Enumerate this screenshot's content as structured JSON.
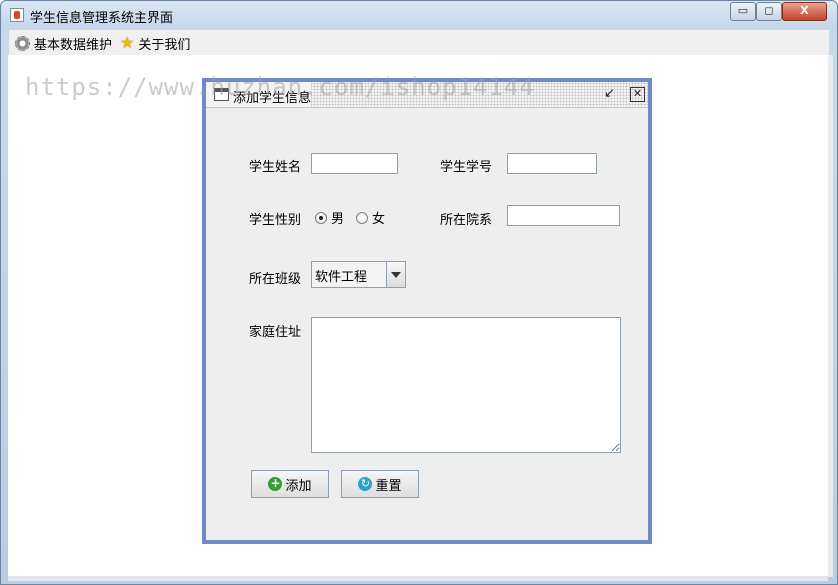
{
  "window": {
    "title": "学生信息管理系统主界面",
    "minimize": "▭",
    "maximize": "◻",
    "close": "X"
  },
  "menubar": {
    "items": [
      {
        "label": "基本数据维护",
        "icon": "gear-icon"
      },
      {
        "label": "关于我们",
        "icon": "star-icon"
      }
    ]
  },
  "watermark": "https://www.huzhan.com/ishop14144",
  "dialog": {
    "title": "添加学生信息",
    "restore": "↙",
    "close": "☒",
    "fields": {
      "name_label": "学生姓名",
      "name_value": "",
      "id_label": "学生学号",
      "id_value": "",
      "gender_label": "学生性别",
      "gender_options": [
        "男",
        "女"
      ],
      "gender_selected": "男",
      "dept_label": "所在院系",
      "dept_value": "",
      "class_label": "所在班级",
      "class_value": "软件工程",
      "address_label": "家庭住址",
      "address_value": ""
    },
    "buttons": {
      "add_label": "添加",
      "reset_label": "重置"
    }
  }
}
